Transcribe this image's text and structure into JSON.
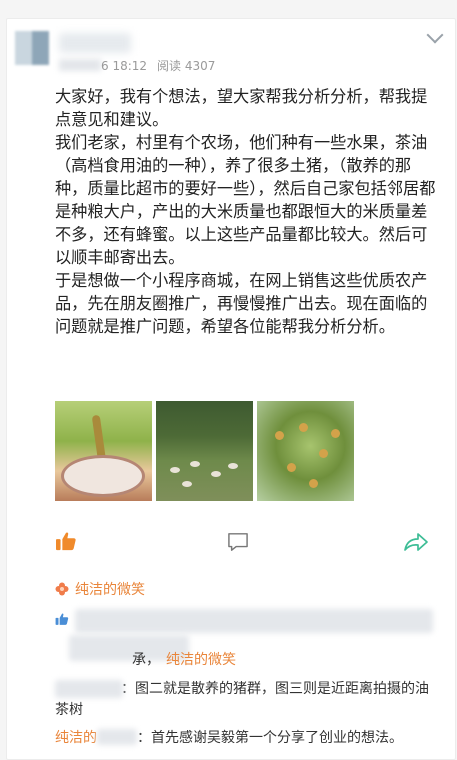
{
  "post": {
    "meta_time": "6 18:12",
    "meta_reads": "阅读 4307",
    "paragraphs": [
      "大家好，我有个想法，望大家帮我分析分析，帮我提点意见和建议。",
      "我们老家，村里有个农场，他们种有一些水果，茶油（高档食用油的一种），养了很多土猪，（散养的那种，质量比超市的要好一些），然后自己家包括邻居都是种粮大户，产出的大米质量也都跟恒大的米质量差不多，还有蜂蜜。以上这些产品量都比较大。然后可以顺丰邮寄出去。",
      "于是想做一个小程序商城，在网上销售这些优质农产品，先在朋友圈推广，再慢慢推广出去。现在面临的问题就是推广问题，希望各位能帮我分析分析。"
    ]
  },
  "liker": {
    "name": "纯洁的微笑"
  },
  "comments": {
    "row2_suffix": "承，",
    "row2_name": "纯洁的微笑",
    "reply1_text": "：图二就是散养的猪群，图三则是近距离拍摄的油茶树",
    "reply2_name": "纯洁的",
    "reply2_text": "：首先感谢吴毅第一个分享了创业的想法。"
  },
  "colors": {
    "accent": "#e9853a",
    "like": "#f08a2b",
    "share": "#3dbd96"
  }
}
